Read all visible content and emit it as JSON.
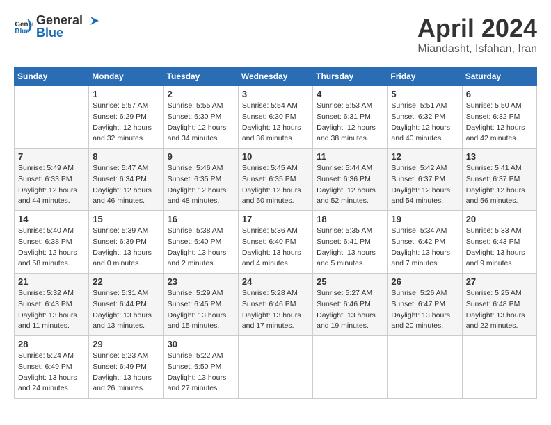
{
  "header": {
    "logo_general": "General",
    "logo_blue": "Blue",
    "month_title": "April 2024",
    "location": "Miandasht, Isfahan, Iran"
  },
  "weekdays": [
    "Sunday",
    "Monday",
    "Tuesday",
    "Wednesday",
    "Thursday",
    "Friday",
    "Saturday"
  ],
  "weeks": [
    [
      {
        "day": "",
        "info": ""
      },
      {
        "day": "1",
        "info": "Sunrise: 5:57 AM\nSunset: 6:29 PM\nDaylight: 12 hours\nand 32 minutes."
      },
      {
        "day": "2",
        "info": "Sunrise: 5:55 AM\nSunset: 6:30 PM\nDaylight: 12 hours\nand 34 minutes."
      },
      {
        "day": "3",
        "info": "Sunrise: 5:54 AM\nSunset: 6:30 PM\nDaylight: 12 hours\nand 36 minutes."
      },
      {
        "day": "4",
        "info": "Sunrise: 5:53 AM\nSunset: 6:31 PM\nDaylight: 12 hours\nand 38 minutes."
      },
      {
        "day": "5",
        "info": "Sunrise: 5:51 AM\nSunset: 6:32 PM\nDaylight: 12 hours\nand 40 minutes."
      },
      {
        "day": "6",
        "info": "Sunrise: 5:50 AM\nSunset: 6:32 PM\nDaylight: 12 hours\nand 42 minutes."
      }
    ],
    [
      {
        "day": "7",
        "info": "Sunrise: 5:49 AM\nSunset: 6:33 PM\nDaylight: 12 hours\nand 44 minutes."
      },
      {
        "day": "8",
        "info": "Sunrise: 5:47 AM\nSunset: 6:34 PM\nDaylight: 12 hours\nand 46 minutes."
      },
      {
        "day": "9",
        "info": "Sunrise: 5:46 AM\nSunset: 6:35 PM\nDaylight: 12 hours\nand 48 minutes."
      },
      {
        "day": "10",
        "info": "Sunrise: 5:45 AM\nSunset: 6:35 PM\nDaylight: 12 hours\nand 50 minutes."
      },
      {
        "day": "11",
        "info": "Sunrise: 5:44 AM\nSunset: 6:36 PM\nDaylight: 12 hours\nand 52 minutes."
      },
      {
        "day": "12",
        "info": "Sunrise: 5:42 AM\nSunset: 6:37 PM\nDaylight: 12 hours\nand 54 minutes."
      },
      {
        "day": "13",
        "info": "Sunrise: 5:41 AM\nSunset: 6:37 PM\nDaylight: 12 hours\nand 56 minutes."
      }
    ],
    [
      {
        "day": "14",
        "info": "Sunrise: 5:40 AM\nSunset: 6:38 PM\nDaylight: 12 hours\nand 58 minutes."
      },
      {
        "day": "15",
        "info": "Sunrise: 5:39 AM\nSunset: 6:39 PM\nDaylight: 13 hours\nand 0 minutes."
      },
      {
        "day": "16",
        "info": "Sunrise: 5:38 AM\nSunset: 6:40 PM\nDaylight: 13 hours\nand 2 minutes."
      },
      {
        "day": "17",
        "info": "Sunrise: 5:36 AM\nSunset: 6:40 PM\nDaylight: 13 hours\nand 4 minutes."
      },
      {
        "day": "18",
        "info": "Sunrise: 5:35 AM\nSunset: 6:41 PM\nDaylight: 13 hours\nand 5 minutes."
      },
      {
        "day": "19",
        "info": "Sunrise: 5:34 AM\nSunset: 6:42 PM\nDaylight: 13 hours\nand 7 minutes."
      },
      {
        "day": "20",
        "info": "Sunrise: 5:33 AM\nSunset: 6:43 PM\nDaylight: 13 hours\nand 9 minutes."
      }
    ],
    [
      {
        "day": "21",
        "info": "Sunrise: 5:32 AM\nSunset: 6:43 PM\nDaylight: 13 hours\nand 11 minutes."
      },
      {
        "day": "22",
        "info": "Sunrise: 5:31 AM\nSunset: 6:44 PM\nDaylight: 13 hours\nand 13 minutes."
      },
      {
        "day": "23",
        "info": "Sunrise: 5:29 AM\nSunset: 6:45 PM\nDaylight: 13 hours\nand 15 minutes."
      },
      {
        "day": "24",
        "info": "Sunrise: 5:28 AM\nSunset: 6:46 PM\nDaylight: 13 hours\nand 17 minutes."
      },
      {
        "day": "25",
        "info": "Sunrise: 5:27 AM\nSunset: 6:46 PM\nDaylight: 13 hours\nand 19 minutes."
      },
      {
        "day": "26",
        "info": "Sunrise: 5:26 AM\nSunset: 6:47 PM\nDaylight: 13 hours\nand 20 minutes."
      },
      {
        "day": "27",
        "info": "Sunrise: 5:25 AM\nSunset: 6:48 PM\nDaylight: 13 hours\nand 22 minutes."
      }
    ],
    [
      {
        "day": "28",
        "info": "Sunrise: 5:24 AM\nSunset: 6:49 PM\nDaylight: 13 hours\nand 24 minutes."
      },
      {
        "day": "29",
        "info": "Sunrise: 5:23 AM\nSunset: 6:49 PM\nDaylight: 13 hours\nand 26 minutes."
      },
      {
        "day": "30",
        "info": "Sunrise: 5:22 AM\nSunset: 6:50 PM\nDaylight: 13 hours\nand 27 minutes."
      },
      {
        "day": "",
        "info": ""
      },
      {
        "day": "",
        "info": ""
      },
      {
        "day": "",
        "info": ""
      },
      {
        "day": "",
        "info": ""
      }
    ]
  ]
}
